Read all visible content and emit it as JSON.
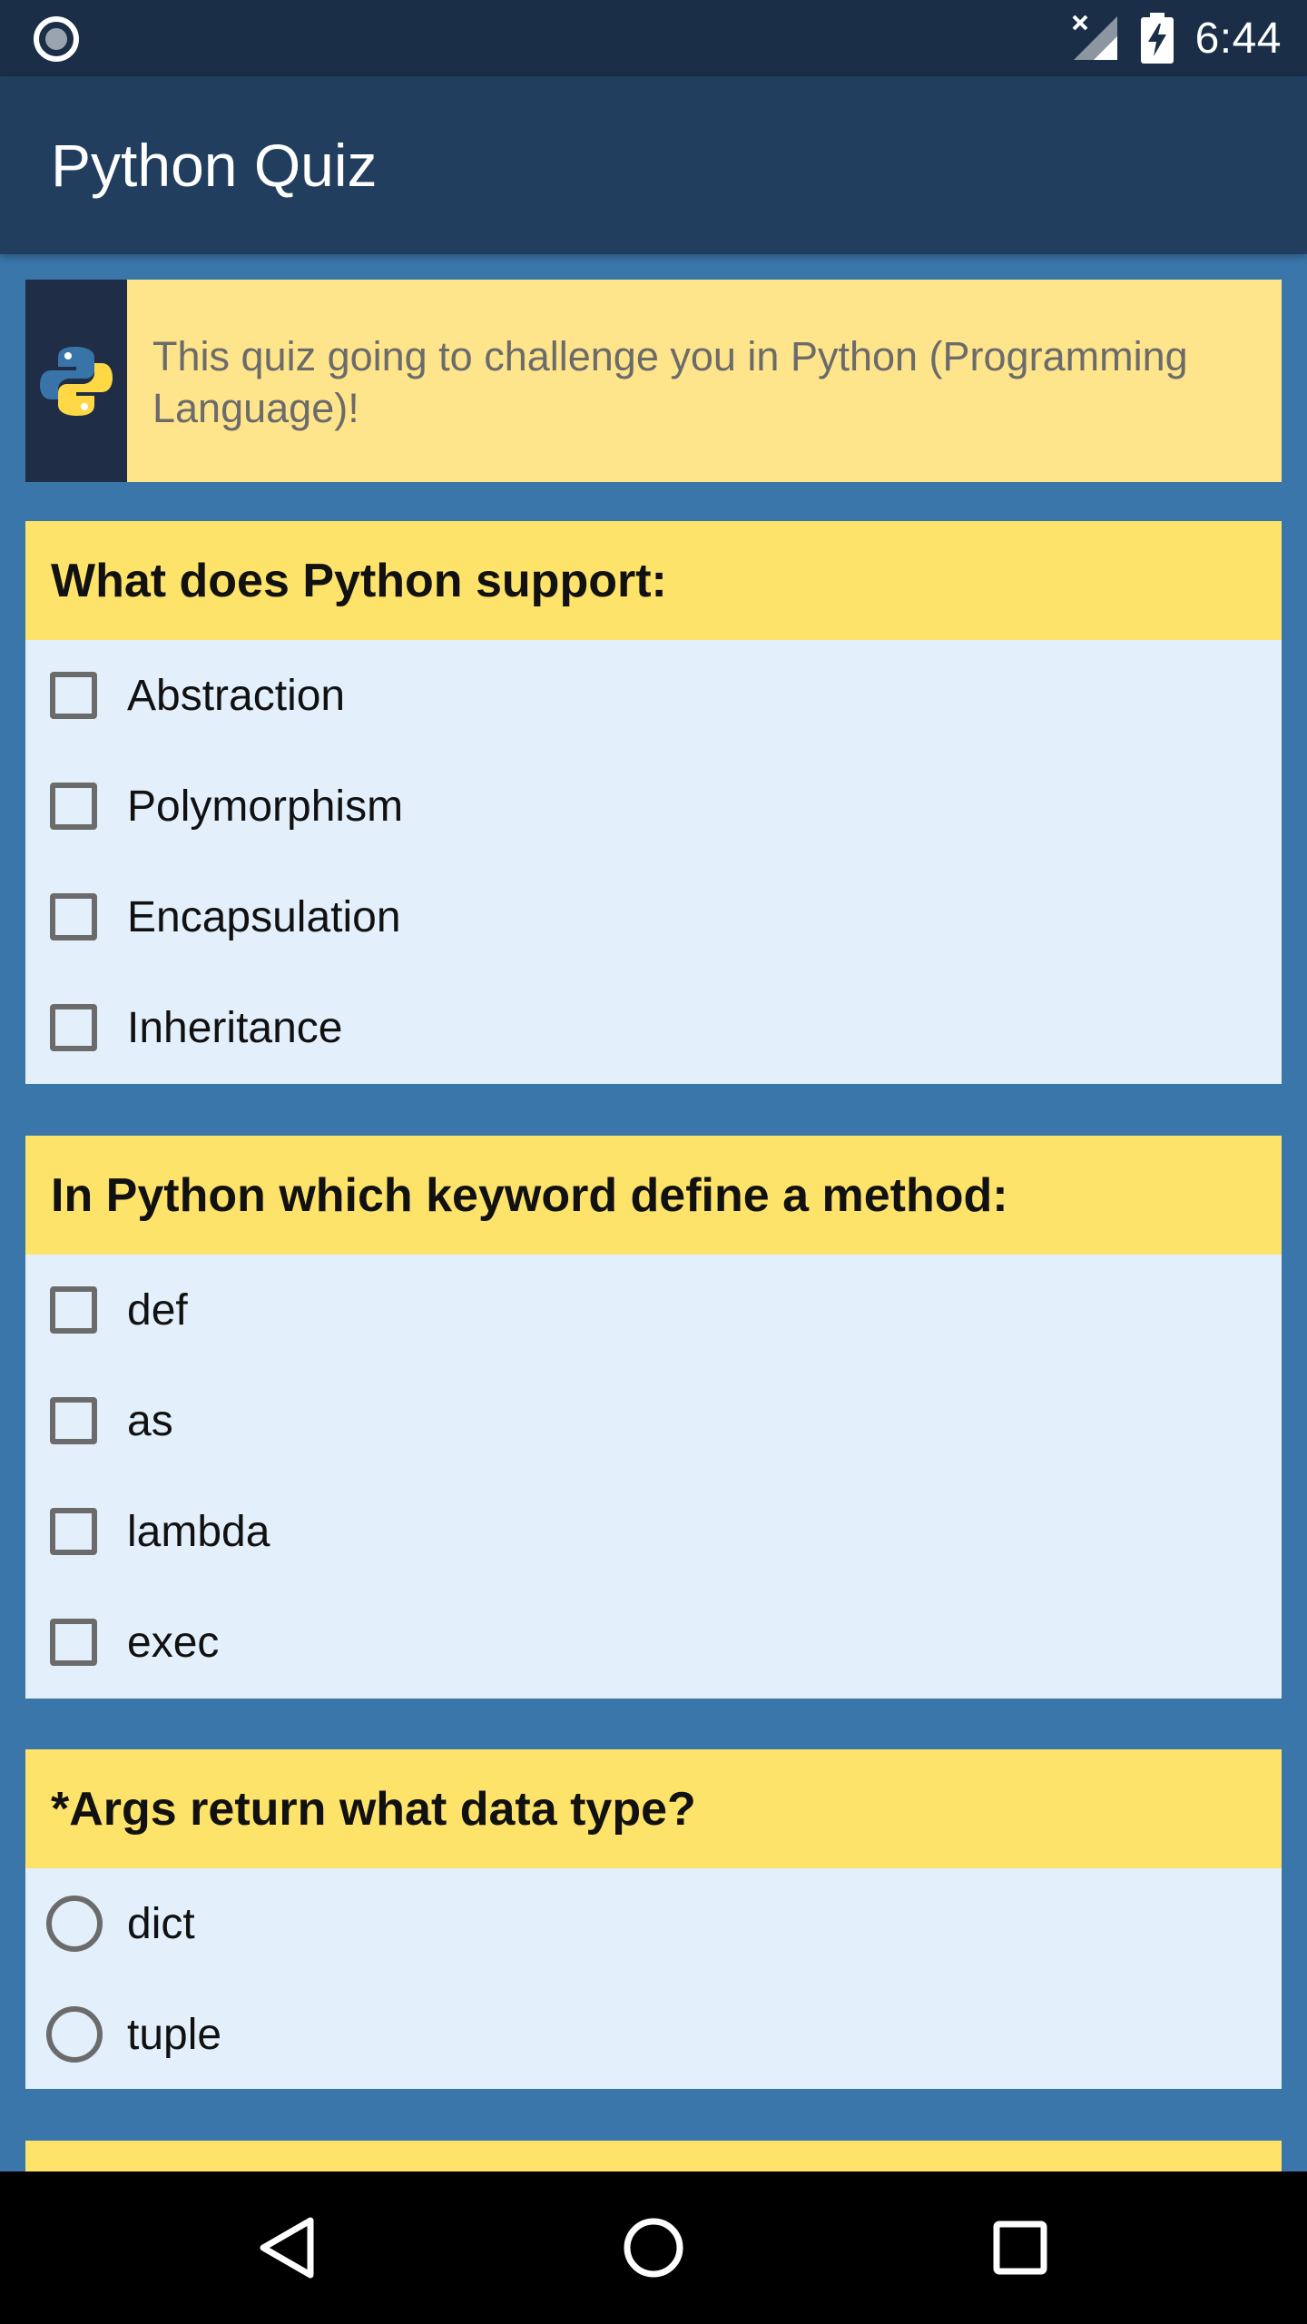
{
  "status_bar": {
    "time": "6:44",
    "icons": [
      "notification-ring-icon",
      "no-signal-icon",
      "battery-charging-icon"
    ]
  },
  "app_bar": {
    "title": "Python Quiz"
  },
  "intro": {
    "icon": "python-logo-icon",
    "text": "This quiz going to challenge you in Python (Programming Language)!"
  },
  "questions": [
    {
      "text": "What does Python support:",
      "input_type": "checkbox",
      "options": [
        "Abstraction",
        "Polymorphism",
        "Encapsulation",
        "Inheritance"
      ]
    },
    {
      "text": "In Python which keyword define a method:",
      "input_type": "checkbox",
      "options": [
        "def",
        "as",
        "lambda",
        "exec"
      ]
    },
    {
      "text": "*Args return what data type?",
      "input_type": "radio",
      "options": [
        "dict",
        "tuple"
      ]
    }
  ],
  "nav_bar": {
    "buttons": [
      "back-icon",
      "home-icon",
      "recents-icon"
    ]
  },
  "colors": {
    "background": "#3b76aa",
    "status_bar": "#1a2e47",
    "app_bar": "#213e5e",
    "question_header": "#fee36a",
    "intro_card": "#fee48a",
    "option_area": "#e3f0fb"
  }
}
